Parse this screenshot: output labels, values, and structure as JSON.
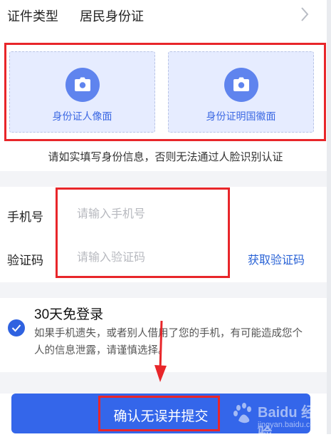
{
  "id_type": {
    "label": "证件类型",
    "value": "居民身份证",
    "icon": "chevron-right-icon"
  },
  "photos": [
    {
      "caption": "身份证人像面",
      "icon": "camera-icon"
    },
    {
      "caption": "身份证明国徽面",
      "icon": "camera-icon"
    }
  ],
  "notice": "请如实填写身份信息，否则无法通过人脸识别认证",
  "form": {
    "phone": {
      "label": "手机号",
      "placeholder": "请输入手机号",
      "value": ""
    },
    "code": {
      "label": "验证码",
      "placeholder": "请输入验证码",
      "value": "",
      "get_code": "获取验证码"
    }
  },
  "login": {
    "title": "30天免登录",
    "description": "如果手机遗失，或者别人借用了您的手机，有可能造成您个人的信息泄露，请谨慎选择。",
    "checked": true
  },
  "submit": {
    "label": "确认无误并提交"
  },
  "watermark": {
    "line1": "Baidu 经验",
    "line2": "jingyan.baidu.com"
  },
  "colors": {
    "accent": "#3466ea",
    "annotation": "#e8262a",
    "card_bg": "#e6ecff"
  }
}
